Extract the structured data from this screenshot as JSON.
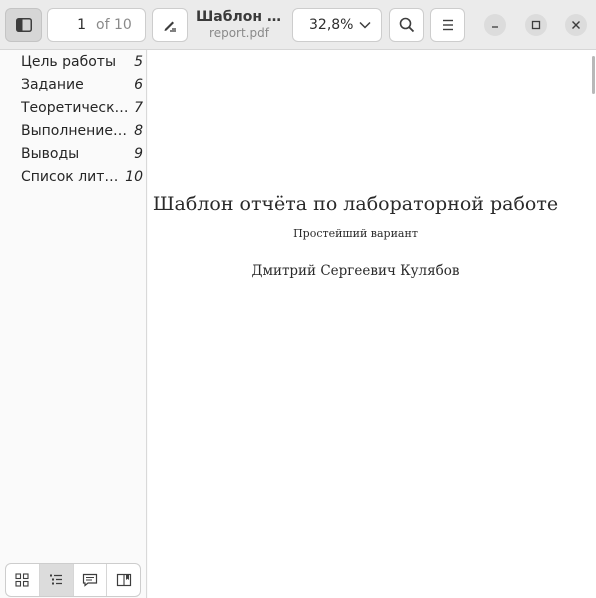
{
  "header": {
    "page_input_value": "1",
    "page_total": "of 10",
    "doc_title": "Шаблон отчёта по лабораторной работе",
    "doc_filename": "report.pdf",
    "zoom": "32,8%"
  },
  "icons": {
    "sidebar_toggle": "sidebar-toggle-icon",
    "annotate": "pen-annotate-icon",
    "zoom_dropdown": "chevron-down-icon",
    "search": "search-icon",
    "menu": "hamburger-menu-icon",
    "minimize": "minimize-icon",
    "maximize": "maximize-icon",
    "close": "close-icon",
    "thumbnails": "grid-icon",
    "outline": "list-icon",
    "annotations": "comment-icon",
    "bookmarks": "bookmark-book-icon"
  },
  "sidebar": {
    "outline": [
      {
        "label": "Цель работы",
        "page": "5"
      },
      {
        "label": "Задание",
        "page": "6"
      },
      {
        "label": "Теоретическое введение",
        "page": "7"
      },
      {
        "label": "Выполнение лабораторной работы",
        "page": "8"
      },
      {
        "label": "Выводы",
        "page": "9"
      },
      {
        "label": "Список литературы",
        "page": "10"
      }
    ]
  },
  "document": {
    "title": "Шаблон отчёта по лабораторной работе",
    "subtitle": "Простейший вариант",
    "author": "Дмитрий Сергеевич Кулябов"
  },
  "colors": {
    "header_bg": "#ebebeb",
    "active_tab": "#dcdcdc",
    "page_bg": "#ffffff"
  }
}
